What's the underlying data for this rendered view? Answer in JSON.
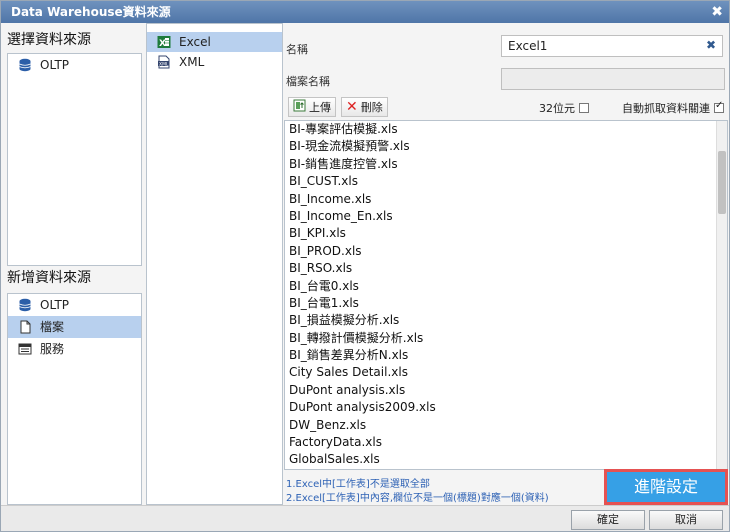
{
  "window": {
    "title": "Data Warehouse資料來源",
    "close_glyph": "✖"
  },
  "left": {
    "select_title": "選擇資料來源",
    "select_items": [
      {
        "label": "OLTP",
        "icon": "database-icon"
      }
    ],
    "add_title": "新增資料來源",
    "add_items": [
      {
        "label": "OLTP",
        "icon": "database-icon"
      },
      {
        "label": "檔案",
        "icon": "file-icon",
        "selected": true
      },
      {
        "label": "服務",
        "icon": "service-icon"
      }
    ]
  },
  "middle": {
    "items": [
      {
        "label": "Excel",
        "icon": "excel-icon",
        "selected": true
      },
      {
        "label": "XML",
        "icon": "xml-icon"
      }
    ]
  },
  "form": {
    "name_label": "名稱",
    "name_value": "Excel1",
    "clear_glyph": "✖",
    "filename_label": "檔案名稱",
    "filename_value": ""
  },
  "toolbar": {
    "upload_label": "上傳",
    "delete_label": "刪除",
    "bit32_label": "32位元",
    "bit32_checked": false,
    "auto_label": "自動抓取資料關連",
    "auto_checked": true
  },
  "files": [
    "BI-專案評估模擬.xls",
    "BI-現金流模擬預警.xls",
    "BI-銷售進度控管.xls",
    "BI_CUST.xls",
    "BI_Income.xls",
    "BI_Income_En.xls",
    "BI_KPI.xls",
    "BI_PROD.xls",
    "BI_RSO.xls",
    "BI_台電0.xls",
    "BI_台電1.xls",
    "BI_損益模擬分析.xls",
    "BI_轉撥計價模擬分析.xls",
    "BI_銷售差異分析N.xls",
    "City Sales Detail.xls",
    "DuPont analysis.xls",
    "DuPont analysis2009.xls",
    "DW_Benz.xls",
    "FactoryData.xls",
    "GlobalSales.xls"
  ],
  "notes": {
    "line1": "1.Excel中[工作表]不是選取全部",
    "line2": "2.Excel[工作表]中內容,欄位不是一個(標題)對應一個(資料)"
  },
  "advanced_label": "進階設定",
  "footer": {
    "ok_label": "確定",
    "cancel_label": "取消"
  },
  "colors": {
    "title_bar": "#5a7fb3",
    "selection": "#b8d0ee",
    "advanced_button": "#36a0e6",
    "highlight_border": "#e55252"
  }
}
